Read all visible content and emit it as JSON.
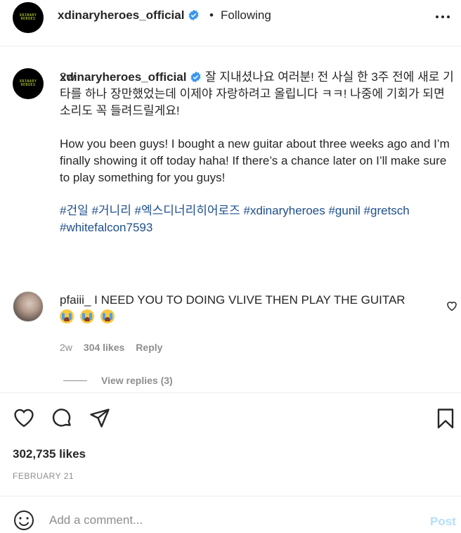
{
  "header": {
    "avatar_text": "XDINARY HEROES",
    "username": "xdinaryheroes_official",
    "verified_icon": "verified-badge-icon",
    "separator": "•",
    "follow_status": "Following",
    "more_icon": "more-options-icon"
  },
  "caption": {
    "username": "xdinaryheroes_official",
    "text_ko": "잘 지내셨나요 여러분! 전 사실 한 3주 전에 새로 기타를 하나 장만했었는데 이제야 자랑하려고 올립니다 ㅋㅋ! 나중에 기회가 되면 소리도 꼭 들려드릴게요!",
    "text_en": "How you been guys! I bought a new guitar about three weeks ago and I’m finally showing it off today haha! If there’s a chance later on I’ll make sure to play something for you guys!",
    "hashtags": "#건일 #거니리 #엑스디너리히어로즈 #xdinaryheroes #gunil #gretsch #whitefalcon7593",
    "time": "2w"
  },
  "comment": {
    "username": "pfaiii_",
    "text": "I NEED YOU TO DOING VLIVE THEN PLAY THE GUITAR",
    "emoji_count": 3,
    "emoji_icon": "loudly-crying-face-icon",
    "time": "2w",
    "likes": "304 likes",
    "reply": "Reply",
    "view_replies": "View replies (3)"
  },
  "actions": {
    "like_icon": "heart-icon",
    "comment_icon": "comment-icon",
    "share_icon": "share-icon",
    "save_icon": "bookmark-icon"
  },
  "post": {
    "likes": "302,735 likes",
    "date": "FEBRUARY 21"
  },
  "add_comment": {
    "placeholder": "Add a comment...",
    "post_label": "Post",
    "emoji_icon": "smile-icon"
  },
  "colors": {
    "hashtag": "#1e4f8c",
    "verified": "#3897f0",
    "post_disabled": "#b2dffc",
    "muted": "#8e8e8e"
  }
}
